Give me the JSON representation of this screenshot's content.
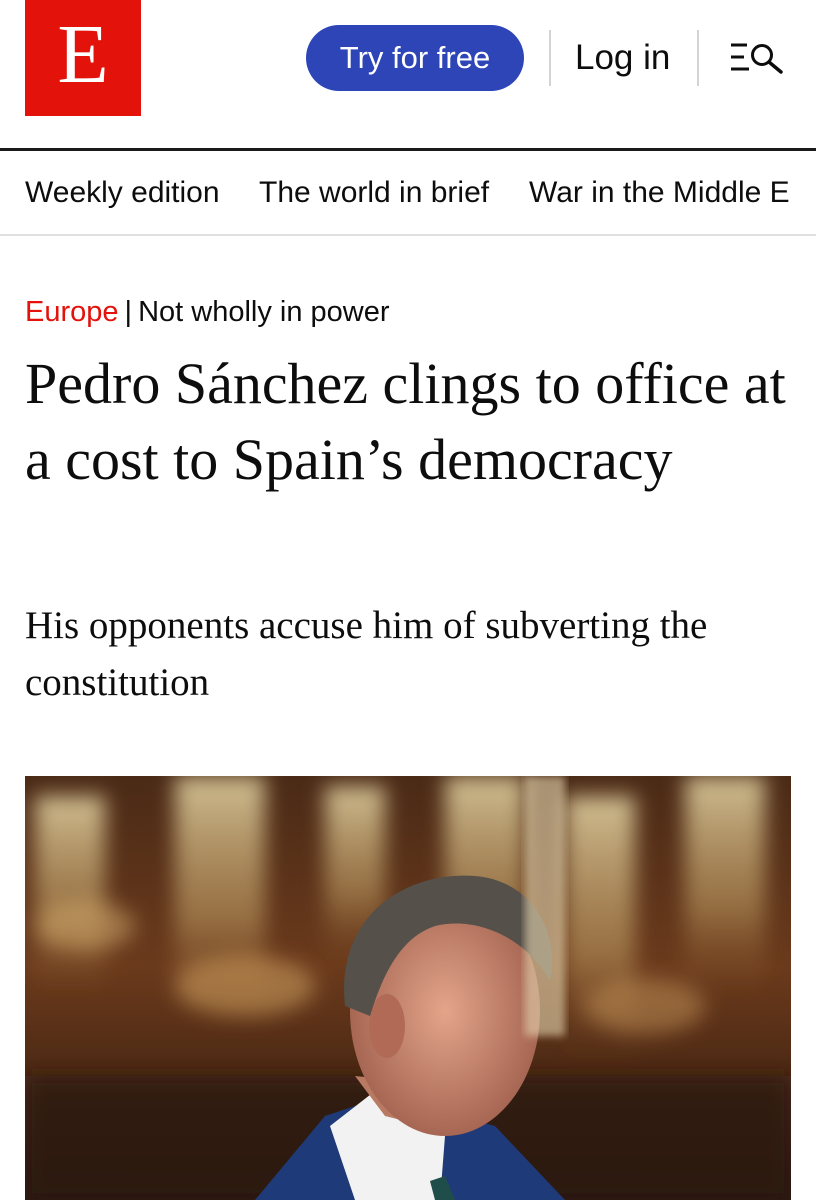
{
  "header": {
    "logo_letter": "E",
    "try_label": "Try for free",
    "login_label": "Log in",
    "menu_icon": "menu-search-icon"
  },
  "nav": {
    "items": [
      "Weekly edition",
      "The world in brief",
      "War in the Middle E"
    ]
  },
  "article": {
    "section": "Europe",
    "separator": "|",
    "rubric": "Not wholly in power",
    "headline": "Pedro Sánchez clings to office at a cost to Spain’s democracy",
    "subheadline": "His opponents accuse him of subverting the constitution"
  },
  "colors": {
    "brand_red": "#e3120b",
    "button_blue": "#2e45b8",
    "text": "#0d0d0d"
  }
}
